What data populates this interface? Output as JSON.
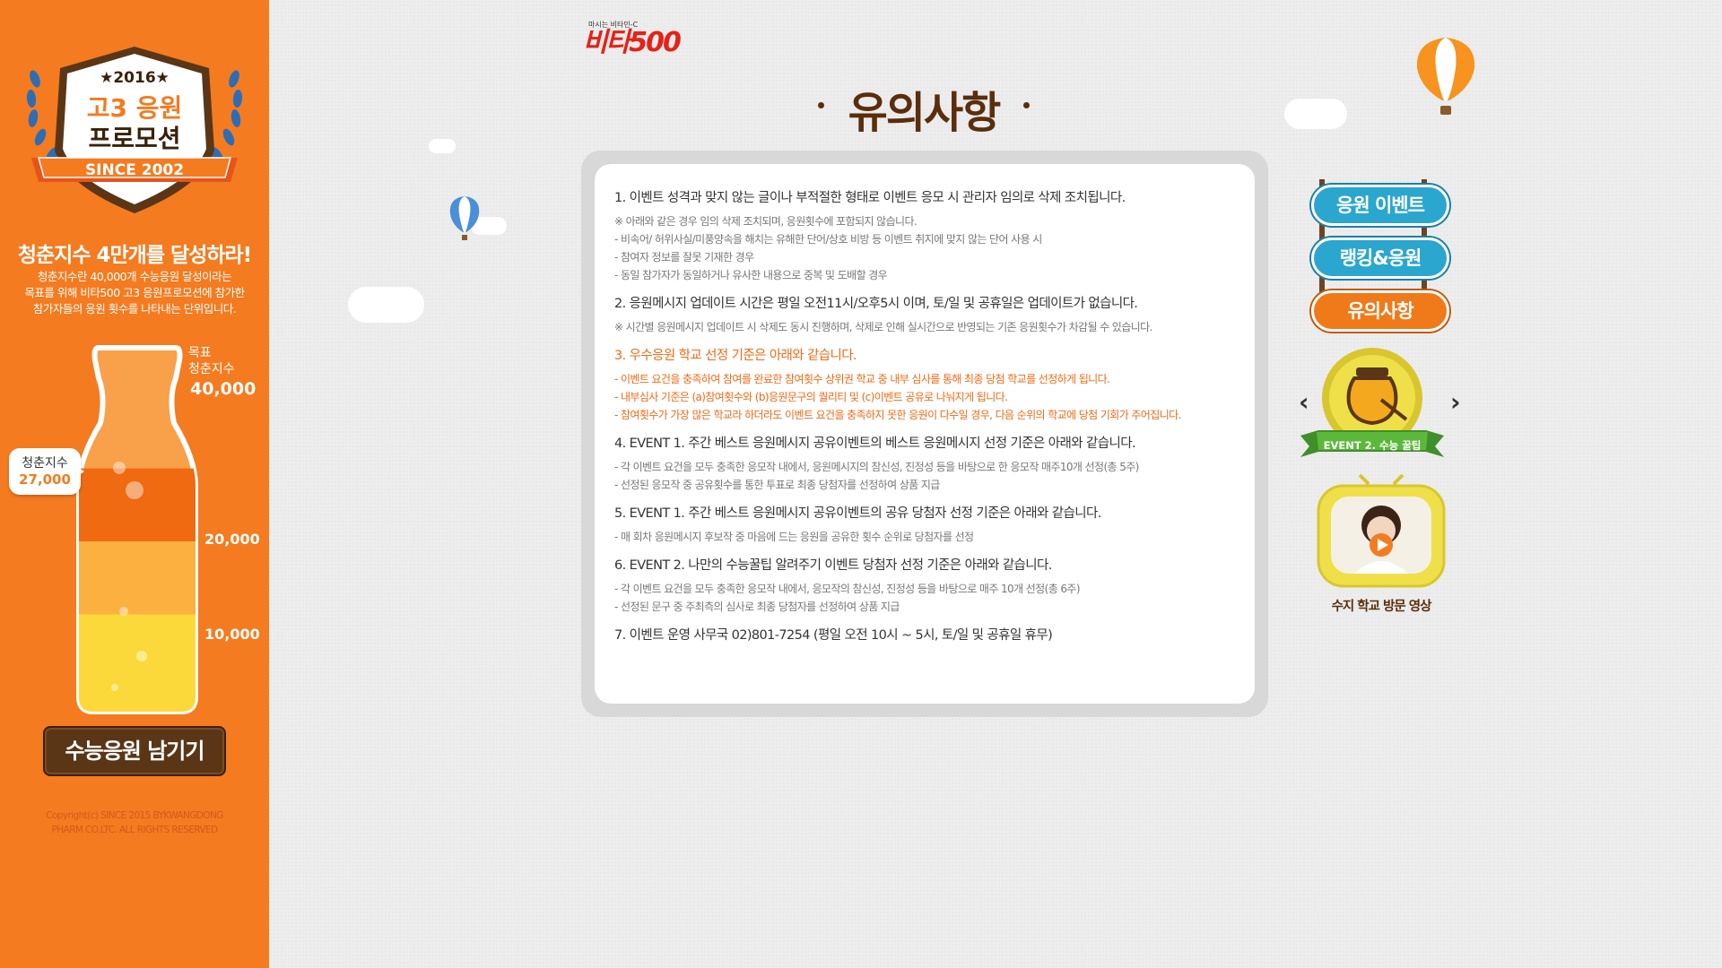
{
  "sidebar": {
    "emblem_year": "★2016★",
    "emblem_line1": "고3 응원",
    "emblem_line2": "프로모션",
    "emblem_since": "SINCE 2002",
    "slogan_title": "청춘지수 4만개를 달성하라!",
    "slogan_desc": "청춘지수란 40,000개 수능응원 달성이라는\n목표를 위해 비타500 고3 응원프로모션에 참가한\n참가자들의 응원 횟수를 나타내는 단위입니다.",
    "goal_label": "목표\n청춘지수",
    "goal_value": "40,000",
    "current_label": "청춘지수",
    "current_value": "27,000",
    "current_progress": 0.675,
    "tick_20000": "20,000",
    "tick_10000": "10,000",
    "cta_label": "수능응원 남기기",
    "copyright": "Copyright(c) SINCE 2015 BYKWANGDONG\nPHARM CO.LTC.  ALL RIGHTS RESERVED"
  },
  "header": {
    "brand_tagline": "마시는 비타민-C",
    "brand_name": "비타500",
    "page_title": "유의사항"
  },
  "notice": {
    "items": [
      {
        "title": "1. 이벤트 성격과 맞지 않는 글이나 부적절한 형태로 이벤트 응모 시 관리자 임의로 삭제 조치됩니다.",
        "lines": [
          "※ 아래와 같은 경우 임의 삭제 조치되며, 응원횟수에 포함되지 않습니다.",
          "- 비속어/ 허위사실/미풍양속을 해치는 유해한 단어/상호 비방 등 이벤트 취지에 맞지 않는 단어 사용 시",
          "- 참여자 정보를 잘못 기재한 경우",
          "- 동일 참가자가 동일하거나 유사한 내용으로 중복 및 도배할 경우"
        ]
      },
      {
        "title": "2. 응원메시지 업데이트 시간은 평일 오전11시/오후5시 이며, 토/일 및 공휴일은 업데이트가 없습니다.",
        "lines": [
          "※ 시간별 응원메시지 업데이트 시 삭제도 동시 진행하며, 삭제로 인해 실시간으로 반영되는 기존 응원횟수가 차감될 수 있습니다."
        ]
      },
      {
        "title": "3. 우수응원 학교 선정 기준은 아래와 같습니다.",
        "lines": [
          "- 이벤트 요건을 충족하여 참여를 완료한 참여횟수 상위권 학교 중 내부 심사를 통해 최종 당첨 학교를 선정하게 됩니다.",
          "- 내부심사 기준은 (a)참여횟수와 (b)응원문구의 퀄리티 및 (c)이벤트 공유로 나눠지게 됩니다.",
          "- 참여횟수가 가장 많은 학교라 하더라도 이벤트 요건을 충족하지 못한 응원이 다수일 경우,  다음 순위의 학교에 당첨 기회가 주어집니다."
        ]
      },
      {
        "title": "4. EVENT 1. 주간 베스트 응원메시지 공유이벤트의 베스트 응원메시지 선정 기준은 아래와 같습니다.",
        "lines": [
          "- 각 이벤트 요건을 모두 충족한 응모작 내에서, 응원메시지의 참신성, 진정성 등을 바탕으로 한 응모작  매주10개 선정(총 5주)",
          "- 선정된 응모작 중 공유횟수를 통한 투표로 최종 당첨자를 선정하여 상품 지급"
        ]
      },
      {
        "title": "5. EVENT 1. 주간 베스트 응원메시지 공유이벤트의 공유 당첨자 선정 기준은 아래와 같습니다.",
        "lines": [
          "- 매 회차 응원메시지 후보작 중 마음에 드는 응원을 공유한 횟수 순위로 당첨자를 선정"
        ]
      },
      {
        "title": "6. EVENT 2. 나만의 수능꿀팁 알려주기 이벤트 당첨자 선정 기준은 아래와 같습니다.",
        "lines": [
          "- 각 이벤트 요건을 모두 충족한 응모작 내에서, 응모작의 참신성, 진정성 등을 바탕으로 매주 10개 선정(총 6주)",
          "- 선정된 문구 중 주최측의 심사로 최종 당첨자를 선정하여 상품 지급"
        ]
      },
      {
        "title": "7. 이벤트 운영 사무국 02)801-7254 (평일 오전 10시 ~ 5시, 토/일 및 공휴일 휴무)",
        "lines": []
      }
    ]
  },
  "nav": {
    "items": [
      {
        "label": "응원 이벤트"
      },
      {
        "label": "랭킹&응원"
      },
      {
        "label": "유의사항"
      }
    ],
    "event_badge_label": "EVENT 2. 수능 꿀팁",
    "video_label": "수지 학교 방문 영상"
  },
  "colors": {
    "sidebar_orange": "#f47b20",
    "title_brown": "#5a2e0c",
    "highlight_orange": "#f06a16",
    "nav_blue": "#2ba6cf"
  }
}
